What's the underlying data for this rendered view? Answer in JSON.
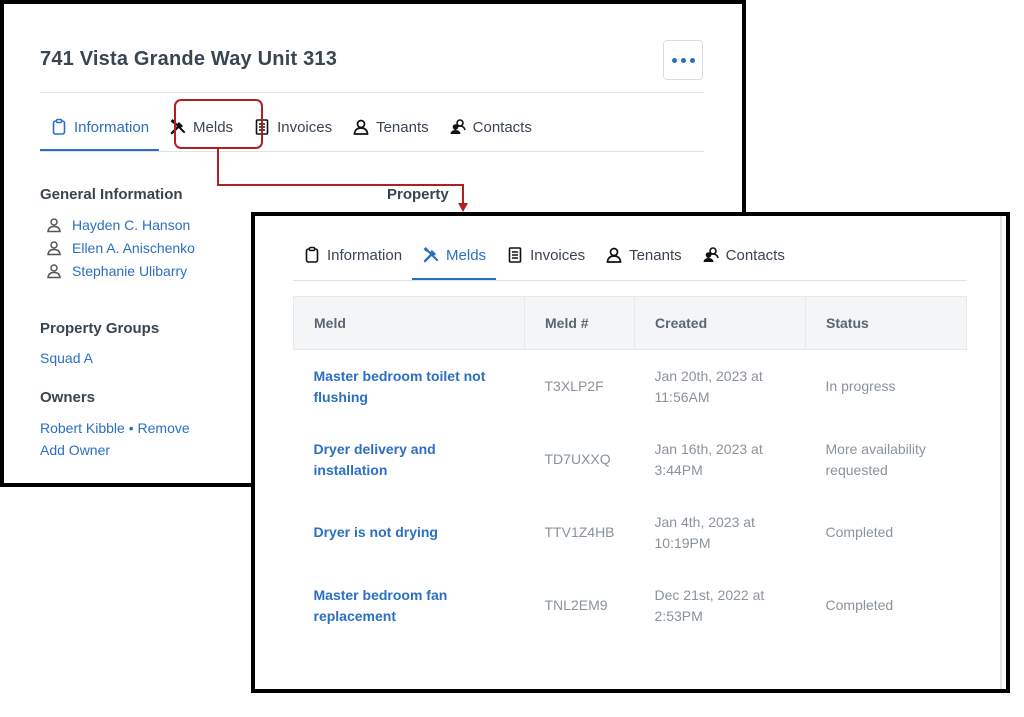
{
  "back": {
    "title": "741 Vista Grande Way Unit 313",
    "tabs": [
      {
        "label": "Information",
        "icon": "clipboard-icon"
      },
      {
        "label": "Melds",
        "icon": "tools-icon"
      },
      {
        "label": "Invoices",
        "icon": "document-icon"
      },
      {
        "label": "Tenants",
        "icon": "person-icon"
      },
      {
        "label": "Contacts",
        "icon": "contacts-icon"
      }
    ],
    "general_info_heading": "General Information",
    "property_heading": "Property",
    "people": [
      "Hayden C. Hanson",
      "Ellen A. Anischenko",
      "Stephanie Ulibarry"
    ],
    "property_groups_heading": "Property Groups",
    "property_group": "Squad A",
    "owners_heading": "Owners",
    "owner_name": "Robert Kibble",
    "owner_separator": "•",
    "remove_label": "Remove",
    "add_owner_label": "Add Owner"
  },
  "front": {
    "tabs": [
      {
        "label": "Information",
        "icon": "clipboard-icon"
      },
      {
        "label": "Melds",
        "icon": "tools-icon"
      },
      {
        "label": "Invoices",
        "icon": "document-icon"
      },
      {
        "label": "Tenants",
        "icon": "person-icon"
      },
      {
        "label": "Contacts",
        "icon": "contacts-icon"
      }
    ],
    "columns": [
      "Meld",
      "Meld #",
      "Created",
      "Status"
    ],
    "rows": [
      {
        "meld": "Master bedroom toilet not flushing",
        "number": "T3XLP2F",
        "created": "Jan 20th, 2023 at 11:56AM",
        "status": "In progress"
      },
      {
        "meld": "Dryer delivery and installation",
        "number": "TD7UXXQ",
        "created": "Jan 16th, 2023 at 3:44PM",
        "status": "More availability requested"
      },
      {
        "meld": "Dryer is not drying",
        "number": "TTV1Z4HB",
        "created": "Jan 4th, 2023 at 10:19PM",
        "status": "Completed"
      },
      {
        "meld": "Master bedroom fan replacement",
        "number": "TNL2EM9",
        "created": "Dec 21st, 2022 at 2:53PM",
        "status": "Completed"
      }
    ]
  },
  "colors": {
    "accent": "#2b6fc2",
    "highlight": "#b01f24",
    "text": "#3a4552"
  }
}
